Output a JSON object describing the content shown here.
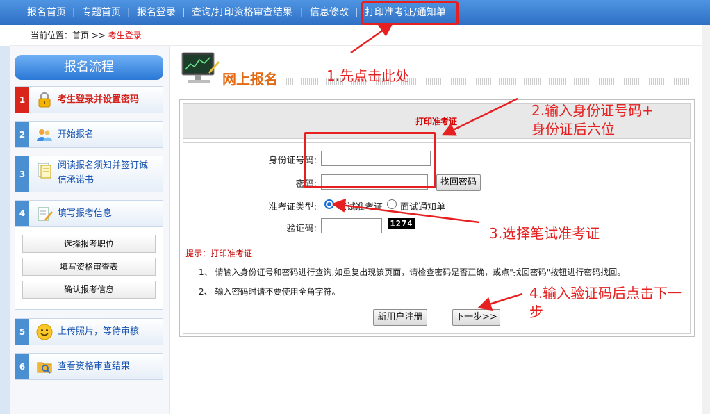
{
  "topnav": {
    "items": [
      "报名首页",
      "专题首页",
      "报名登录",
      "查询/打印资格审查结果",
      "信息修改",
      "打印准考证/通知单"
    ],
    "separator": "|"
  },
  "breadcrumb": {
    "prefix": "当前位置：",
    "home": "首页",
    "arrow": ">>",
    "current": "考生登录"
  },
  "sidebar": {
    "title": "报名流程",
    "steps": [
      {
        "num": "1",
        "label": "考生登录并设置密码",
        "icon": "lock-icon"
      },
      {
        "num": "2",
        "label": "开始报名",
        "icon": "users-icon"
      },
      {
        "num": "3",
        "label_line1": "阅读报名须知并签订诚",
        "label_line2": "信承诺书",
        "icon": "document-icon"
      },
      {
        "num": "4",
        "label": "填写报考信息",
        "icon": "edit-icon"
      },
      {
        "num": "5",
        "label": "上传照片，等待审核",
        "icon": "smiley-icon"
      },
      {
        "num": "6",
        "label": "查看资格审查结果",
        "icon": "folder-icon"
      }
    ],
    "sub_buttons": [
      "选择报考职位",
      "填写资格审查表",
      "确认报考信息"
    ]
  },
  "main": {
    "header_title": "网上报名",
    "header_icon": "monitor-chart-icon"
  },
  "form": {
    "title": "打印准考证",
    "id_label": "身份证号码:",
    "id_value": "",
    "password_label": "密码:",
    "password_value": "",
    "recover_button": "找回密码",
    "type_label": "准考证类型:",
    "type_options": [
      "笔试准考证",
      "面试通知单"
    ],
    "type_selected": "笔试准考证",
    "captcha_label": "验证码:",
    "captcha_value": "",
    "captcha_text": "1274",
    "tip_label": "提示：打印准考证",
    "notes": [
      "1、 请输入身份证号和密码进行查询,如重复出现该页面，请检查密码是否正确，或点\"找回密码\"按钮进行密码找回。",
      "2、 输入密码时请不要使用全角字符。"
    ],
    "register_button": "新用户注册",
    "next_button": "下一步>>"
  },
  "annotations": {
    "step1": "1.先点击此处",
    "step2_line1": "2.输入身份证号码+",
    "step2_line2": "身份证后六位",
    "step3": "3.选择笔试准考证",
    "step4_line1": "4.输入验证码后点击下一",
    "step4_line2": "步",
    "color": "#e62020"
  }
}
